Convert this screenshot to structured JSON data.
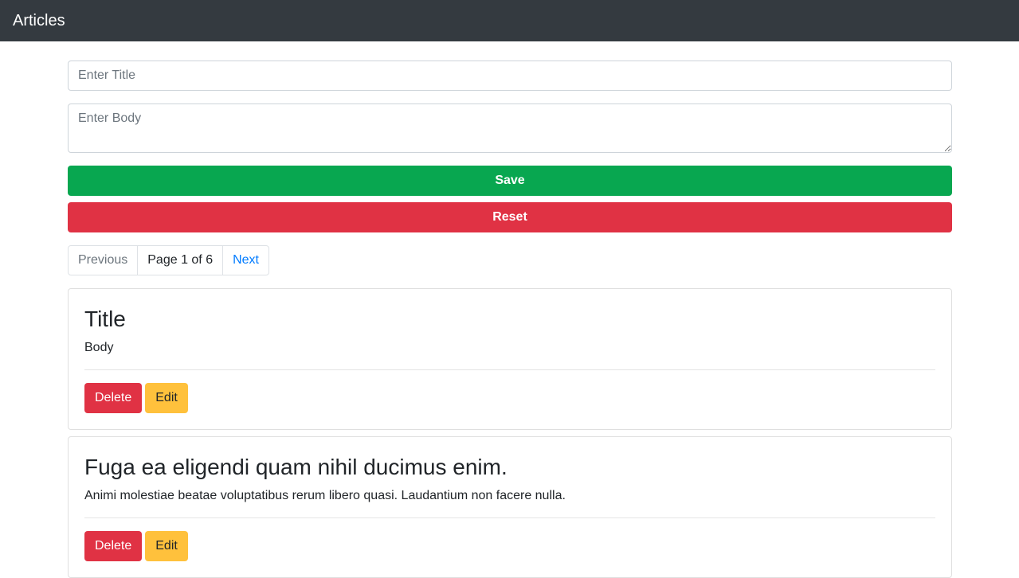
{
  "navbar": {
    "brand": "Articles"
  },
  "form": {
    "title_placeholder": "Enter Title",
    "body_placeholder": "Enter Body",
    "save_label": "Save",
    "reset_label": "Reset"
  },
  "pagination": {
    "previous_label": "Previous",
    "page_info": "Page 1 of 6",
    "next_label": "Next"
  },
  "articles": [
    {
      "title": "Title",
      "body": "Body",
      "delete_label": "Delete",
      "edit_label": "Edit"
    },
    {
      "title": "Fuga ea eligendi quam nihil ducimus enim.",
      "body": "Animi molestiae beatae voluptatibus rerum libero quasi. Laudantium non facere nulla.",
      "delete_label": "Delete",
      "edit_label": "Edit"
    }
  ],
  "colors": {
    "navbar": "#343a40",
    "save": "#08a750",
    "danger": "#e03244",
    "warning": "#ffc13c",
    "link": "#007bff"
  }
}
